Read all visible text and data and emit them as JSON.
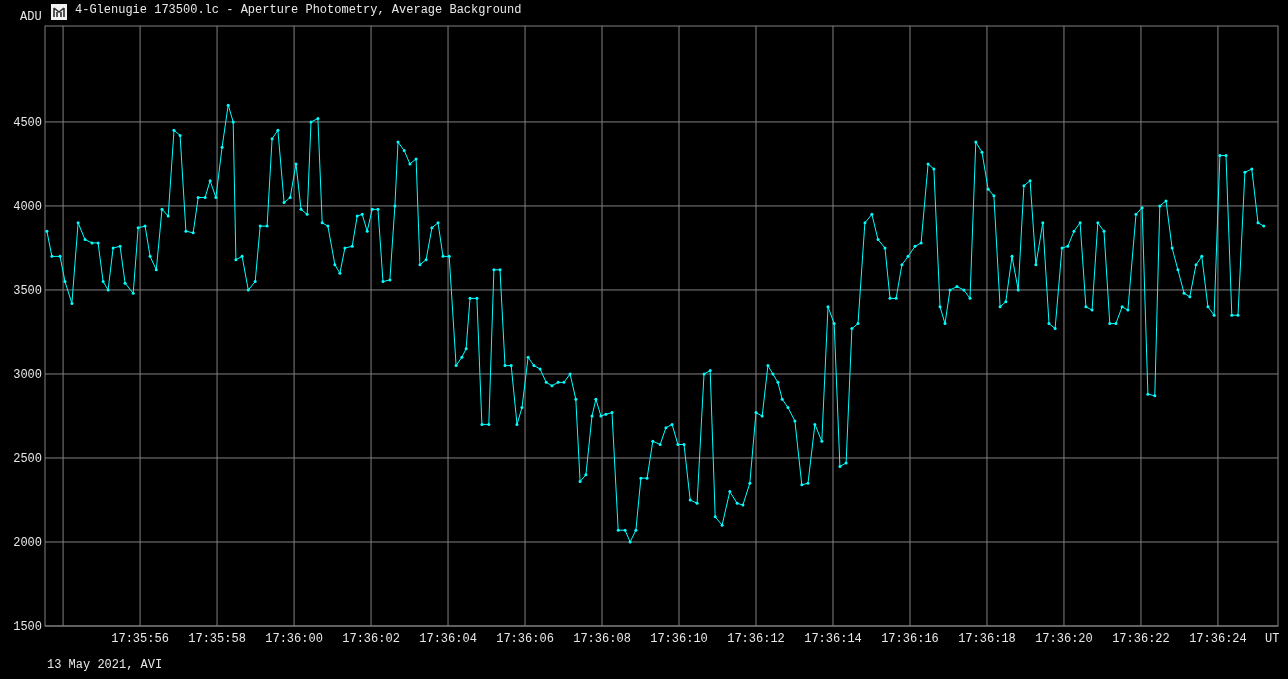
{
  "window": {
    "title": "4-Glenugie 173500.lc - Aperture Photometry, Average Background"
  },
  "chart": {
    "chart_data": {
      "type": "line",
      "grid": true,
      "ylabel": "ADU",
      "xlabel": "UT",
      "xlim": [
        63353.53,
        63385.56
      ],
      "ylim": [
        1500,
        5071
      ],
      "yticks": [
        1500,
        2000,
        2500,
        3000,
        3500,
        4000,
        4500
      ],
      "xticks": [
        {
          "value": 63356,
          "label": "17:35:56"
        },
        {
          "value": 63358,
          "label": "17:35:58"
        },
        {
          "value": 63360,
          "label": "17:36:00"
        },
        {
          "value": 63362,
          "label": "17:36:02"
        },
        {
          "value": 63364,
          "label": "17:36:04"
        },
        {
          "value": 63366,
          "label": "17:36:06"
        },
        {
          "value": 63368,
          "label": "17:36:08"
        },
        {
          "value": 63370,
          "label": "17:36:10"
        },
        {
          "value": 63372,
          "label": "17:36:12"
        },
        {
          "value": 63374,
          "label": "17:36:14"
        },
        {
          "value": 63376,
          "label": "17:36:16"
        },
        {
          "value": 63378,
          "label": "17:36:18"
        },
        {
          "value": 63380,
          "label": "17:36:20"
        },
        {
          "value": 63382,
          "label": "17:36:22"
        },
        {
          "value": 63384,
          "label": "17:36:24"
        }
      ],
      "x": [
        63353.58,
        63353.71,
        63353.92,
        63354.05,
        63354.23,
        63354.39,
        63354.57,
        63354.75,
        63354.91,
        63355.04,
        63355.17,
        63355.3,
        63355.48,
        63355.61,
        63355.82,
        63355.95,
        63356.13,
        63356.26,
        63356.42,
        63356.57,
        63356.73,
        63356.88,
        63357.04,
        63357.19,
        63357.38,
        63357.51,
        63357.69,
        63357.82,
        63357.97,
        63358.13,
        63358.29,
        63358.42,
        63358.49,
        63358.65,
        63358.81,
        63358.99,
        63359.12,
        63359.3,
        63359.43,
        63359.58,
        63359.74,
        63359.9,
        63360.05,
        63360.18,
        63360.34,
        63360.44,
        63360.62,
        63360.73,
        63360.88,
        63361.06,
        63361.19,
        63361.32,
        63361.51,
        63361.64,
        63361.77,
        63361.9,
        63362.03,
        63362.18,
        63362.31,
        63362.49,
        63362.62,
        63362.7,
        63362.86,
        63363.01,
        63363.17,
        63363.27,
        63363.43,
        63363.58,
        63363.74,
        63363.87,
        63364.03,
        63364.21,
        63364.36,
        63364.47,
        63364.57,
        63364.75,
        63364.88,
        63365.06,
        63365.19,
        63365.35,
        63365.48,
        63365.64,
        63365.79,
        63365.92,
        63366.08,
        63366.23,
        63366.39,
        63366.55,
        63366.7,
        63366.86,
        63367.01,
        63367.17,
        63367.32,
        63367.43,
        63367.58,
        63367.74,
        63367.84,
        63367.97,
        63368.1,
        63368.26,
        63368.42,
        63368.6,
        63368.73,
        63368.88,
        63369.01,
        63369.17,
        63369.32,
        63369.51,
        63369.66,
        63369.82,
        63369.97,
        63370.13,
        63370.29,
        63370.47,
        63370.65,
        63370.81,
        63370.94,
        63371.12,
        63371.32,
        63371.51,
        63371.66,
        63371.84,
        63372.0,
        63372.16,
        63372.31,
        63372.44,
        63372.57,
        63372.68,
        63372.83,
        63373.01,
        63373.19,
        63373.35,
        63373.53,
        63373.71,
        63373.87,
        63374.03,
        63374.18,
        63374.34,
        63374.49,
        63374.65,
        63374.83,
        63375.01,
        63375.17,
        63375.35,
        63375.48,
        63375.64,
        63375.79,
        63375.95,
        63376.13,
        63376.29,
        63376.47,
        63376.62,
        63376.78,
        63376.91,
        63377.04,
        63377.22,
        63377.4,
        63377.56,
        63377.71,
        63377.87,
        63378.03,
        63378.18,
        63378.34,
        63378.49,
        63378.65,
        63378.81,
        63378.96,
        63379.12,
        63379.27,
        63379.45,
        63379.61,
        63379.77,
        63379.95,
        63380.1,
        63380.26,
        63380.42,
        63380.57,
        63380.73,
        63380.88,
        63381.04,
        63381.19,
        63381.35,
        63381.51,
        63381.66,
        63381.87,
        63382.03,
        63382.18,
        63382.36,
        63382.49,
        63382.65,
        63382.81,
        63382.96,
        63383.12,
        63383.27,
        63383.43,
        63383.58,
        63383.74,
        63383.9,
        63384.05,
        63384.21,
        63384.36,
        63384.52,
        63384.7,
        63384.88,
        63385.04,
        63385.19
      ],
      "series": [
        {
          "color": "#00ffff",
          "values": [
            3850,
            3700,
            3700,
            3550,
            3420,
            3900,
            3800,
            3780,
            3780,
            3550,
            3500,
            3750,
            3760,
            3540,
            3480,
            3870,
            3880,
            3700,
            3620,
            3980,
            3940,
            4450,
            4420,
            3850,
            3840,
            4050,
            4050,
            4150,
            4050,
            4350,
            4600,
            4500,
            3680,
            3700,
            3500,
            3550,
            3880,
            3880,
            4400,
            4450,
            4020,
            4050,
            4250,
            3980,
            3950,
            4500,
            4520,
            3900,
            3880,
            3650,
            3600,
            3750,
            3760,
            3940,
            3950,
            3850,
            3980,
            3980,
            3550,
            3560,
            4000,
            4380,
            4330,
            4250,
            4280,
            3650,
            3680,
            3870,
            3900,
            3700,
            3700,
            3050,
            3100,
            3150,
            3450,
            3450,
            2700,
            2700,
            3620,
            3620,
            3050,
            3050,
            2700,
            2800,
            3100,
            3050,
            3030,
            2950,
            2930,
            2950,
            2950,
            3000,
            2850,
            2360,
            2400,
            2750,
            2850,
            2750,
            2760,
            2770,
            2070,
            2070,
            2000,
            2070,
            2380,
            2380,
            2600,
            2580,
            2680,
            2700,
            2580,
            2580,
            2250,
            2230,
            3000,
            3020,
            2150,
            2100,
            2300,
            2230,
            2220,
            2350,
            2770,
            2750,
            3050,
            3000,
            2950,
            2850,
            2800,
            2720,
            2340,
            2350,
            2700,
            2600,
            3400,
            3300,
            2450,
            2470,
            3270,
            3300,
            3900,
            3950,
            3800,
            3750,
            3450,
            3450,
            3650,
            3700,
            3760,
            3780,
            4250,
            4220,
            3400,
            3300,
            3500,
            3520,
            3500,
            3450,
            4380,
            4320,
            4100,
            4060,
            3400,
            3430,
            3700,
            3500,
            4120,
            4150,
            3650,
            3900,
            3300,
            3270,
            3750,
            3760,
            3850,
            3900,
            3400,
            3380,
            3900,
            3850,
            3300,
            3300,
            3400,
            3380,
            3950,
            3990,
            2880,
            2870,
            4000,
            4030,
            3750,
            3620,
            3480,
            3460,
            3650,
            3700,
            3400,
            3350,
            4300,
            4300,
            3350,
            3350,
            4200,
            4220,
            3900,
            3880
          ]
        }
      ]
    }
  },
  "footer": {
    "caption": "13 May 2021, AVI"
  }
}
